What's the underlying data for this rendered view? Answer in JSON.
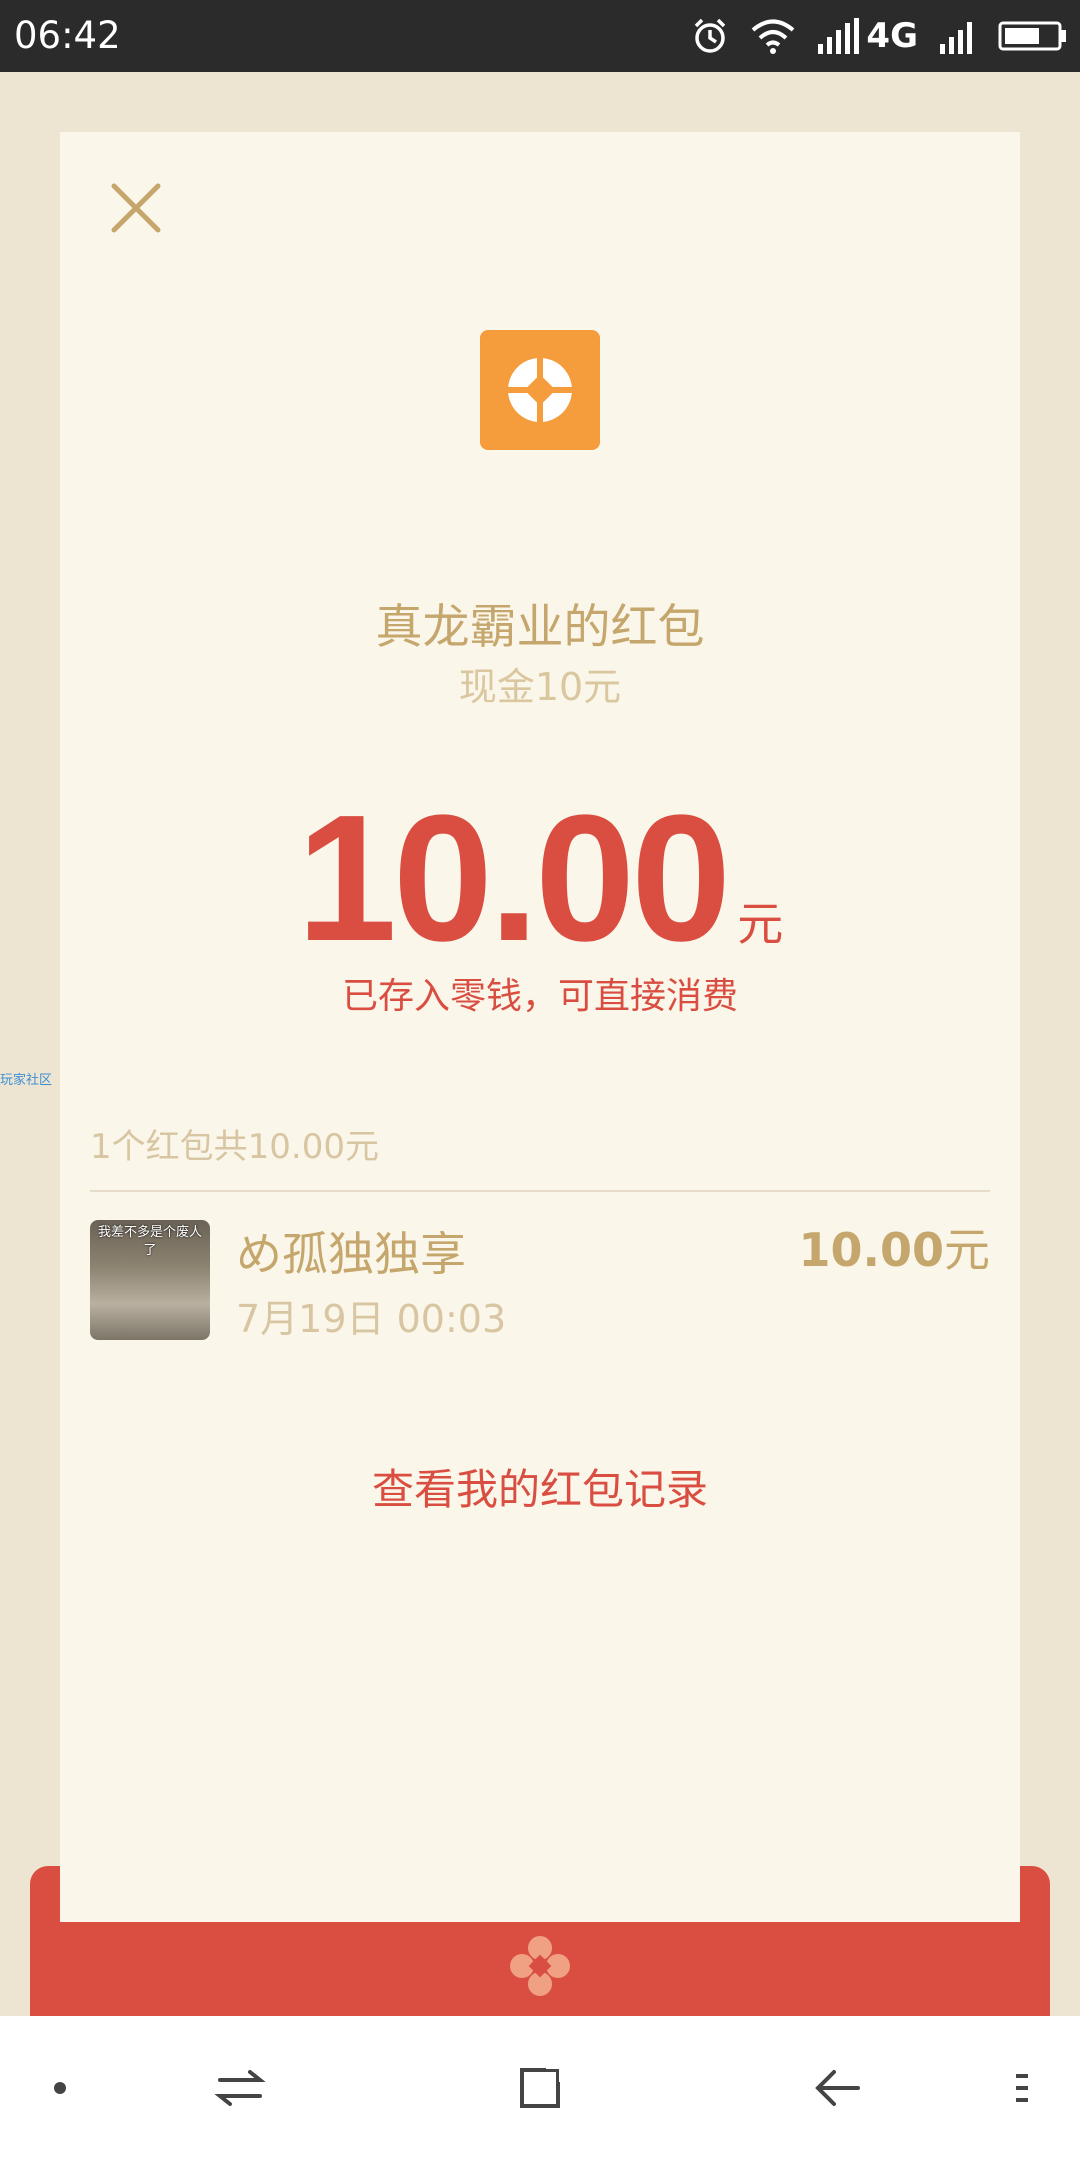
{
  "status_bar": {
    "time": "06:42",
    "network": "4G",
    "icons": [
      "alarm-icon",
      "wifi-icon",
      "signal-icon",
      "signal-icon",
      "battery-icon"
    ]
  },
  "card": {
    "close_icon": "close-icon",
    "logo_icon": "app-logo-icon",
    "logo_color": "#F59C3C",
    "sender_title": "真龙霸业的红包",
    "subtitle": "现金10元",
    "amount": "10.00",
    "amount_unit": "元",
    "deposit_note": "已存入零钱，可直接消费",
    "summary": "1个红包共10.00元",
    "records": [
      {
        "avatar_caption": "我差不多是个废人了",
        "name": "め孤独独享",
        "time": "7月19日  00:03",
        "amount": "10.00",
        "amount_unit": "元"
      }
    ],
    "history_link": "查看我的红包记录"
  },
  "side_mark": "玩家社区",
  "colors": {
    "accent_red": "#D94E41",
    "gold_text": "#C5A66C",
    "light_gold_text": "#D8C6A2",
    "card_background": "#FBF6EA",
    "page_background": "#EDE5D2"
  },
  "nav_bar": {
    "icons": [
      "menu-dot-icon",
      "switch-icon",
      "home-square-icon",
      "back-icon",
      "more-icon"
    ]
  }
}
